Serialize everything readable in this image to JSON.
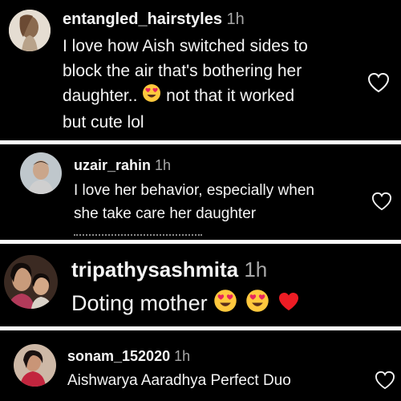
{
  "comments": [
    {
      "username": "entangled_hairstyles",
      "time": "1h",
      "text_1": "I love how Aish switched sides to",
      "text_2": "block the air that's bothering her",
      "text_3a": "daughter.. ",
      "text_3b": " not that it worked",
      "text_4": "but cute lol",
      "emojis": [
        "heart-eyes-emoji"
      ],
      "like_icon": "heart-outline-icon",
      "avatar": "avatar"
    },
    {
      "username": "uzair_rahin",
      "time": "1h",
      "text_1": "I love her behavior, especially when",
      "text_2": "she take care her daughter",
      "like_icon": "heart-outline-icon",
      "avatar": "avatar"
    },
    {
      "username": "tripathysashmita",
      "time": "1h",
      "text_a": "Doting mother ",
      "emojis": [
        "heart-eyes-emoji",
        "heart-eyes-emoji",
        "red-heart-emoji"
      ],
      "avatar": "avatar"
    },
    {
      "username": "sonam_152020",
      "time": "1h",
      "text_1": "Aishwarya Aaradhya Perfect Duo",
      "like_icon": "heart-outline-icon",
      "avatar": "avatar"
    }
  ],
  "colors": {
    "background": "#000000",
    "separator": "#ffffff",
    "text": "#f5f5f5",
    "muted": "#a8a8a8",
    "heart_red": "#ed1c24",
    "emoji_face": "#ffc83d"
  }
}
